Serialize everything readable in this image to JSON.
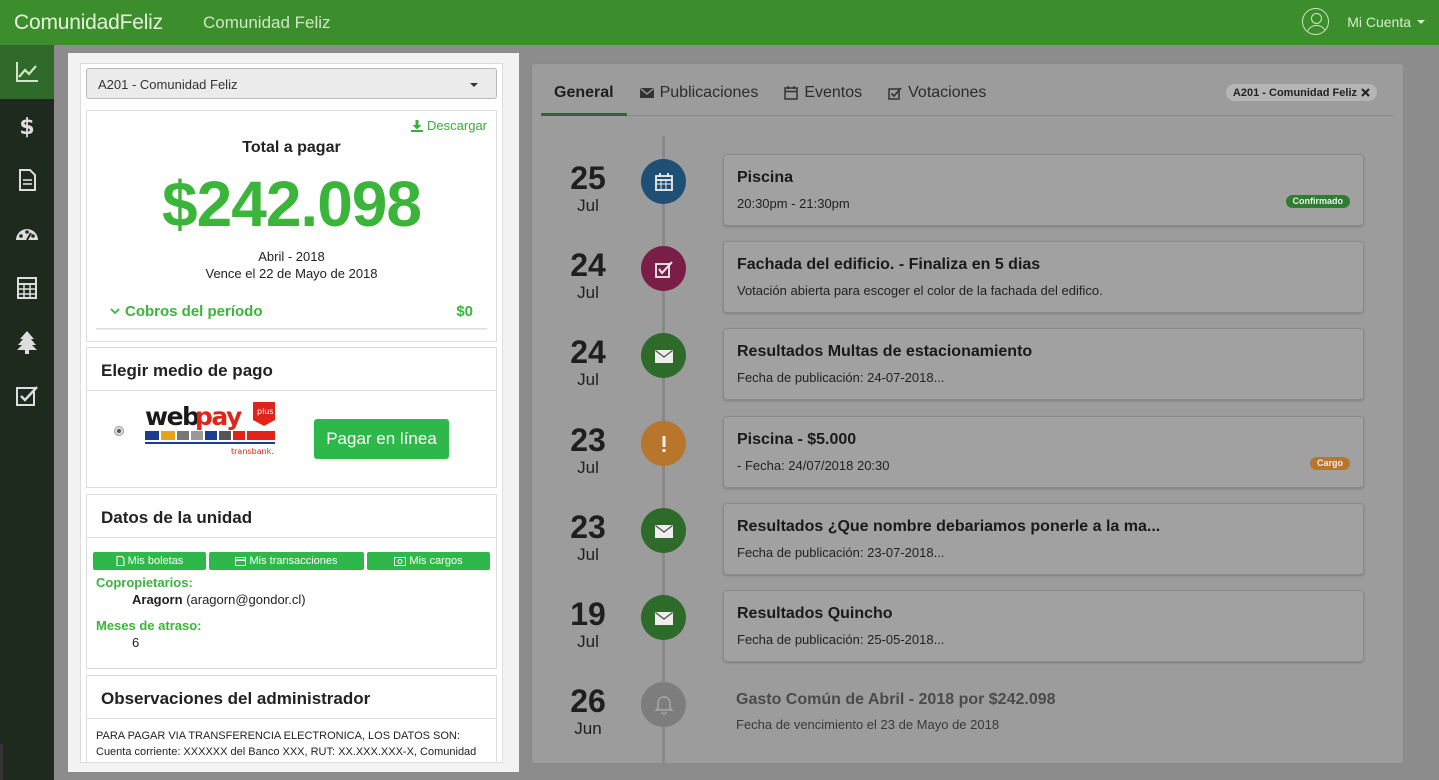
{
  "topbar": {
    "brand": "ComunidadFeliz",
    "community": "Comunidad Feliz",
    "account": "Mi Cuenta"
  },
  "sidebar": {
    "items": [
      "chart-line-icon",
      "dollar-icon",
      "document-icon",
      "dashboard-icon",
      "calculator-icon",
      "tree-icon",
      "checkbox-icon"
    ]
  },
  "left": {
    "select_value": "A201 - Comunidad Feliz",
    "download": "Descargar",
    "total_label": "Total a pagar",
    "amount": "$242.098",
    "period": "Abril - 2018",
    "due": "Vence el 22 de Mayo de 2018",
    "cobros_label": "Cobros del período",
    "cobros_amount": "$0",
    "payment": {
      "title": "Elegir medio de pago",
      "button": "Pagar en línea"
    },
    "unit": {
      "title": "Datos de la unidad",
      "buttons": [
        "Mis boletas",
        "Mis transacciones",
        "Mis cargos"
      ],
      "owners_label": "Copropietarios:",
      "owner_name": "Aragorn",
      "owner_email": "(aragorn@gondor.cl)",
      "months_label": "Meses de atraso:",
      "months_value": "6"
    },
    "obs": {
      "title": "Observaciones del administrador",
      "text": "PARA PAGAR VIA TRANSFERENCIA ELECTRONICA, LOS DATOS SON: Cuenta corriente: XXXXXX del Banco XXX, RUT: XX.XXX.XXX-X, Comunidad"
    }
  },
  "right": {
    "tabs": [
      "General",
      "Publicaciones",
      "Eventos",
      "Votaciones"
    ],
    "badge": "A201 - Comunidad Feliz",
    "events": [
      {
        "day": "25",
        "month": "Jul",
        "title": "Piscina",
        "sub": "20:30pm - 21:30pm",
        "pill": "Confirmado",
        "icon": "calendar-icon",
        "color": "#1f4f75"
      },
      {
        "day": "24",
        "month": "Jul",
        "title": "Fachada del edificio. - Finaliza en 5 dias",
        "sub": "Votación abierta para escoger el color de la fachada del edifico.",
        "pill": "",
        "icon": "vote-icon",
        "color": "#7a1d47"
      },
      {
        "day": "24",
        "month": "Jul",
        "title": "Resultados Multas de estacionamiento",
        "sub": "Fecha de publicación: 24-07-2018...",
        "pill": "",
        "icon": "envelope-icon",
        "color": "#2e6a2a"
      },
      {
        "day": "23",
        "month": "Jul",
        "title": "Piscina - $5.000",
        "sub": "- Fecha: 24/07/2018 20:30",
        "pill": "Cargo",
        "icon": "exclamation-icon",
        "color": "#b8752c"
      },
      {
        "day": "23",
        "month": "Jul",
        "title": "Resultados ¿Que nombre debariamos ponerle a la ma...",
        "sub": "Fecha de publicación: 23-07-2018...",
        "pill": "",
        "icon": "envelope-icon",
        "color": "#2e6a2a"
      },
      {
        "day": "19",
        "month": "Jul",
        "title": "Resultados Quincho",
        "sub": "Fecha de publicación: 25-05-2018...",
        "pill": "",
        "icon": "envelope-icon",
        "color": "#2e6a2a"
      },
      {
        "day": "26",
        "month": "Jun",
        "title": "Gasto Común de Abril - 2018 por $242.098",
        "sub": "Fecha de vencimiento el 23 de Mayo de 2018",
        "pill": "",
        "icon": "bell-icon",
        "color": "#7d7d7d"
      }
    ]
  },
  "colors": {
    "green": "#3c8d2b",
    "accent": "#3ab53a",
    "confirm": "#2e7d32",
    "cargo": "#b8752c"
  }
}
